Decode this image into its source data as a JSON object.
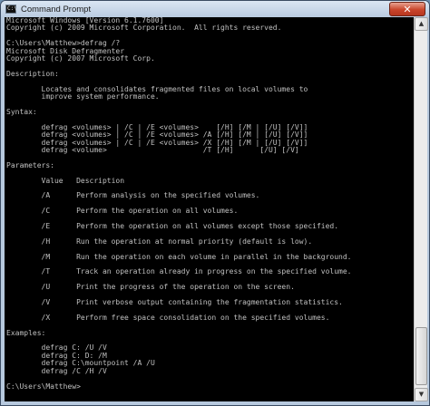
{
  "window": {
    "title": "Command Prompt",
    "app_icon_glyph": "C:\\",
    "close_glyph": "✕"
  },
  "console": {
    "lines": [
      "Microsoft Windows [Version 6.1.7600]",
      "Copyright (c) 2009 Microsoft Corporation.  All rights reserved.",
      "",
      "C:\\Users\\Matthew>defrag /?",
      "Microsoft Disk Defragmenter",
      "Copyright (c) 2007 Microsoft Corp.",
      "",
      "Description:",
      "",
      "        Locates and consolidates fragmented files on local volumes to",
      "        improve system performance.",
      "",
      "Syntax:",
      "",
      "        defrag <volumes> | /C | /E <volumes>    [/H] [/M | [/U] [/V]]",
      "        defrag <volumes> | /C | /E <volumes> /A [/H] [/M | [/U] [/V]]",
      "        defrag <volumes> | /C | /E <volumes> /X [/H] [/M | [/U] [/V]]",
      "        defrag <volume>                      /T [/H]      [/U] [/V]",
      "",
      "Parameters:",
      "",
      "        Value   Description",
      "",
      "        /A      Perform analysis on the specified volumes.",
      "",
      "        /C      Perform the operation on all volumes.",
      "",
      "        /E      Perform the operation on all volumes except those specified.",
      "",
      "        /H      Run the operation at normal priority (default is low).",
      "",
      "        /M      Run the operation on each volume in parallel in the background.",
      "",
      "        /T      Track an operation already in progress on the specified volume.",
      "",
      "        /U      Print the progress of the operation on the screen.",
      "",
      "        /V      Print verbose output containing the fragmentation statistics.",
      "",
      "        /X      Perform free space consolidation on the specified volumes.",
      "",
      "Examples:",
      "",
      "        defrag C: /U /V",
      "        defrag C: D: /M",
      "        defrag C:\\mountpoint /A /U",
      "        defrag /C /H /V",
      "",
      "C:\\Users\\Matthew>"
    ]
  },
  "scrollbar": {
    "up_glyph": "▲",
    "down_glyph": "▼",
    "position_fraction": 0.86
  },
  "colors": {
    "console_background": "#000000",
    "console_text": "#c0c0c0",
    "close_button": "#c9452b",
    "frame": "#b7c9de"
  }
}
